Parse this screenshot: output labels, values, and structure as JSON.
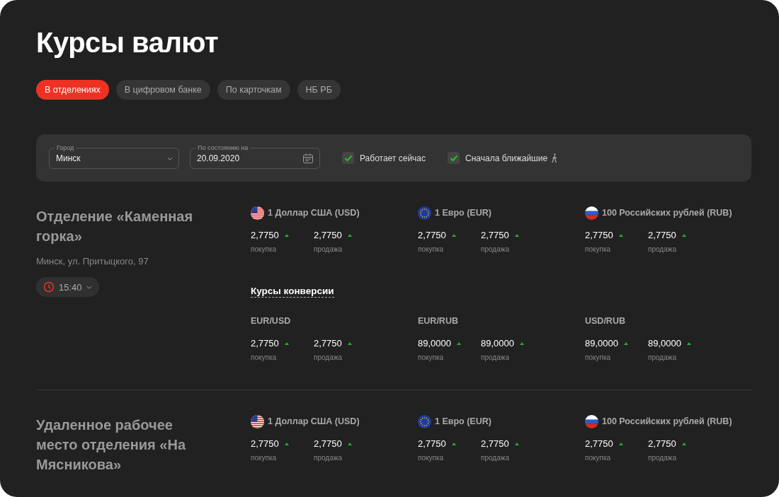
{
  "title": "Курсы валют",
  "tabs": [
    {
      "label": "В отделениях",
      "selected": true
    },
    {
      "label": "В цифровом банке",
      "selected": false
    },
    {
      "label": "По карточкам",
      "selected": false
    },
    {
      "label": "НБ РБ",
      "selected": false
    }
  ],
  "filters": {
    "city": {
      "label": "Город",
      "value": "Минск"
    },
    "date": {
      "label": "По состоянию на",
      "value": "20.09.2020"
    },
    "checkboxes": [
      {
        "label": "Работает сейчас",
        "checked": true
      },
      {
        "label": "Сначала ближайшие",
        "checked": true
      }
    ]
  },
  "branches": [
    {
      "name": "Отделение «Каменная горка»",
      "address": "Минск, ул. Притыцкого, 97",
      "time": "15:40",
      "currencies": [
        {
          "title": "1 Доллар США (USD)",
          "buy": "2,7750",
          "sell": "2,7750",
          "buy_label": "покупка",
          "sell_label": "продажа"
        },
        {
          "title": "1 Евро (EUR)",
          "buy": "2,7750",
          "sell": "2,7750",
          "buy_label": "покупка",
          "sell_label": "продажа"
        },
        {
          "title": "100 Российских рублей (RUB)",
          "buy": "2,7750",
          "sell": "2,7750",
          "buy_label": "покупка",
          "sell_label": "продажа"
        }
      ],
      "conversion_title": "Курсы конверсии",
      "conversions": [
        {
          "title": "EUR/USD",
          "buy": "2,7750",
          "sell": "2,7750",
          "buy_label": "покупка",
          "sell_label": "продажа"
        },
        {
          "title": "EUR/RUB",
          "buy": "89,0000",
          "sell": "89,0000",
          "buy_label": "покупка",
          "sell_label": "продажа"
        },
        {
          "title": "USD/RUB",
          "buy": "89,0000",
          "sell": "89,0000",
          "buy_label": "покупка",
          "sell_label": "продажа"
        }
      ]
    },
    {
      "name": "Удаленное рабочее место отделения «На Мясникова»",
      "currencies": [
        {
          "title": "1 Доллар США (USD)",
          "buy": "2,7750",
          "sell": "2,7750",
          "buy_label": "покупка",
          "sell_label": "продажа"
        },
        {
          "title": "1 Евро (EUR)",
          "buy": "2,7750",
          "sell": "2,7750",
          "buy_label": "покупка",
          "sell_label": "продажа"
        },
        {
          "title": "100 Российских рублей (RUB)",
          "buy": "2,7750",
          "sell": "2,7750",
          "buy_label": "покупка",
          "sell_label": "продажа"
        }
      ]
    }
  ]
}
